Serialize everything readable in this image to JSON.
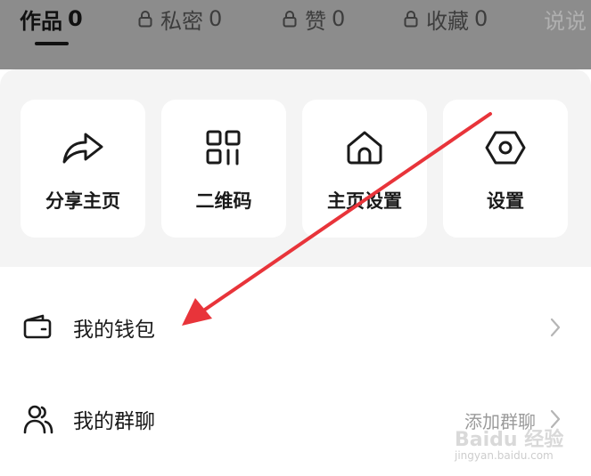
{
  "tabs": [
    {
      "label": "作品",
      "count": "0",
      "locked": false,
      "active": true
    },
    {
      "label": "私密",
      "count": "0",
      "locked": true,
      "active": false
    },
    {
      "label": "赞",
      "count": "0",
      "locked": true,
      "active": false
    },
    {
      "label": "收藏",
      "count": "0",
      "locked": true,
      "active": false
    },
    {
      "label": "说说",
      "count": "",
      "locked": false,
      "active": false
    }
  ],
  "quick_actions": [
    {
      "label": "分享主页",
      "icon": "share-arrow-icon"
    },
    {
      "label": "二维码",
      "icon": "qr-code-icon"
    },
    {
      "label": "主页设置",
      "icon": "home-icon"
    },
    {
      "label": "设置",
      "icon": "hexagon-gear-icon"
    }
  ],
  "menu": [
    {
      "label": "我的钱包",
      "icon": "wallet-icon",
      "extra": ""
    },
    {
      "label": "我的群聊",
      "icon": "group-users-icon",
      "extra": "添加群聊"
    }
  ],
  "watermark": {
    "brand": "Baidu 经验",
    "url": "jingyan.baidu.com"
  },
  "colors": {
    "accent_arrow": "#e8343a",
    "dim_overlay": "#8c8c8c",
    "panel_bg": "#f4f4f4"
  }
}
